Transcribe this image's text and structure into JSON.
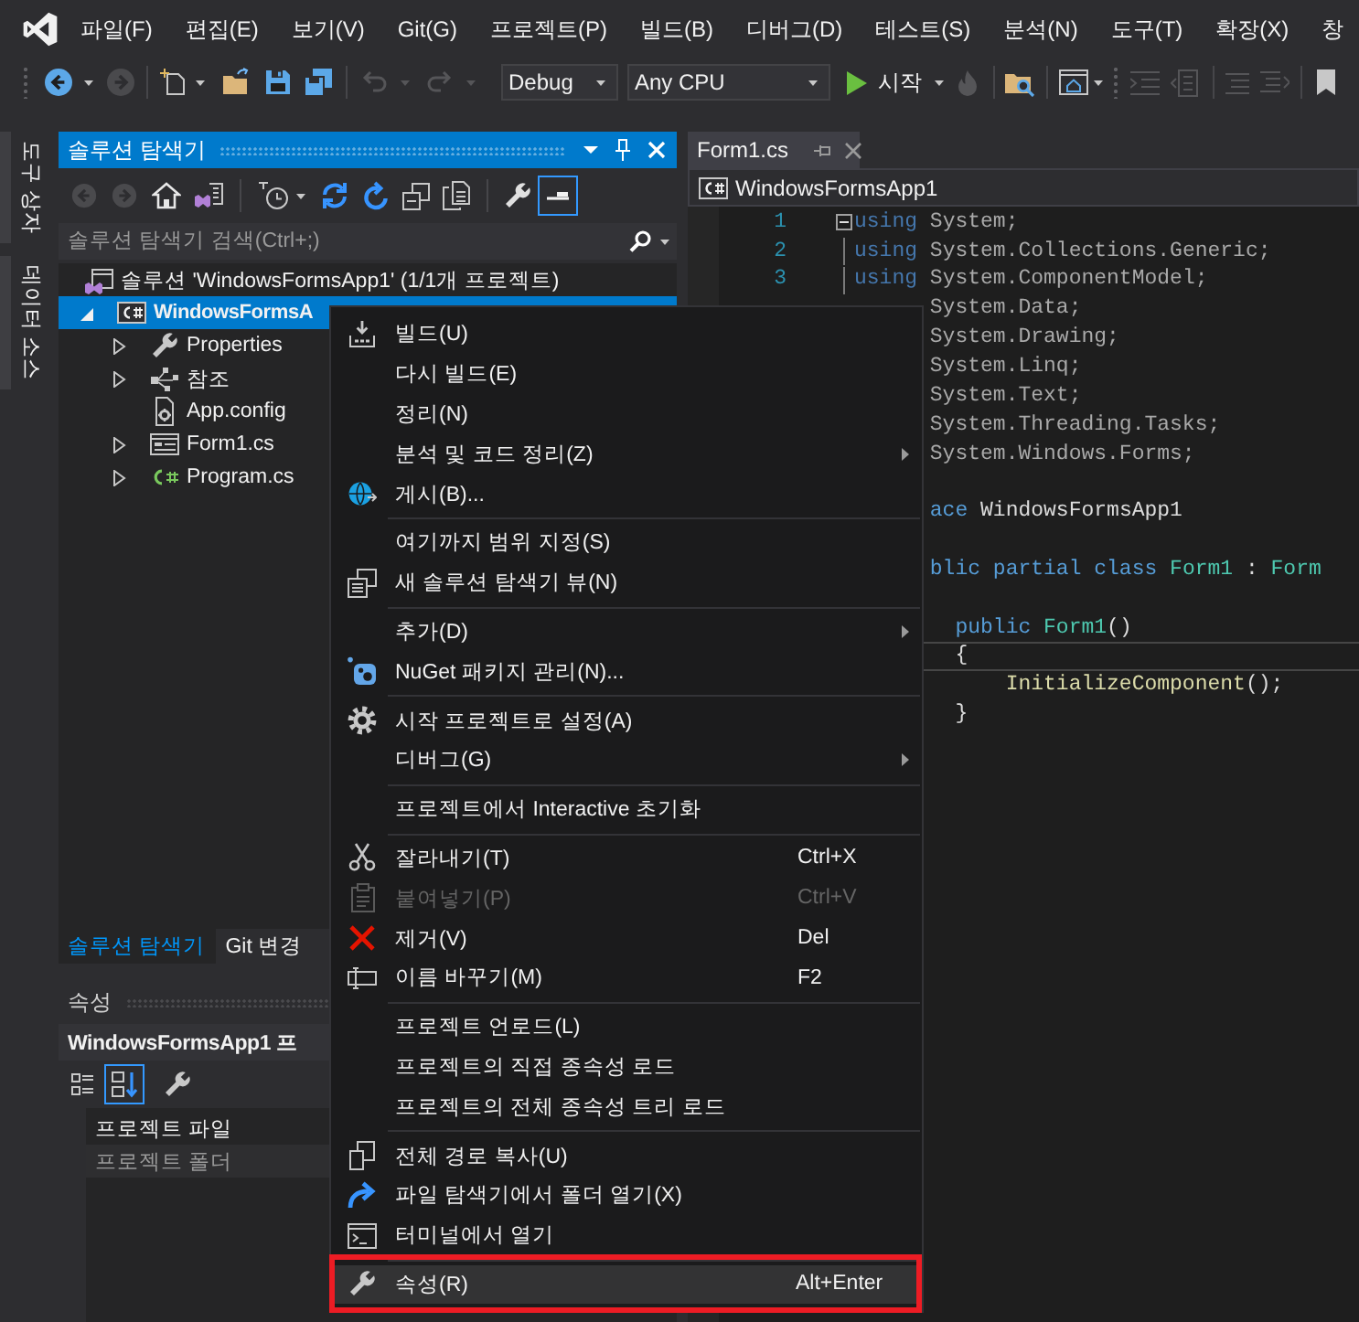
{
  "menu_bar": {
    "items": [
      {
        "label": "파일(F)"
      },
      {
        "label": "편집(E)"
      },
      {
        "label": "보기(V)"
      },
      {
        "label": "Git(G)"
      },
      {
        "label": "프로젝트(P)"
      },
      {
        "label": "빌드(B)"
      },
      {
        "label": "디버그(D)"
      },
      {
        "label": "테스트(S)"
      },
      {
        "label": "분석(N)"
      },
      {
        "label": "도구(T)"
      },
      {
        "label": "확장(X)"
      },
      {
        "label": "창"
      }
    ]
  },
  "toolbar": {
    "history": [
      {
        "disabled": false
      },
      {
        "disabled": true
      }
    ],
    "file": [
      {
        "disabled": false
      },
      {
        "disabled": false
      },
      {
        "disabled": false
      },
      {
        "disabled": false
      }
    ],
    "edit": [
      {
        "disabled": true
      },
      {
        "disabled": true
      }
    ],
    "configuration": "Debug",
    "platform": "Any CPU",
    "start": "시작",
    "tools": [
      {
        "disabled": true
      },
      {
        "disabled": false
      },
      {
        "disabled": false
      },
      {
        "disabled": true
      },
      {
        "disabled": true
      },
      {
        "disabled": true
      },
      {
        "disabled": true
      },
      {
        "disabled": false
      }
    ]
  },
  "side_tabs": [
    {
      "label": "도구 상자"
    },
    {
      "label": "데이터 소스"
    }
  ],
  "solution_explorer": {
    "title": "솔루션 탐색기",
    "active": true,
    "tools": [
      {
        "disabled": true
      },
      {
        "disabled": true
      },
      {
        "disabled": false
      },
      {
        "disabled": false
      },
      {
        "disabled": false
      },
      {
        "disabled": false
      },
      {
        "disabled": false
      },
      {
        "disabled": false
      },
      {
        "disabled": false
      },
      {
        "disabled": false
      }
    ],
    "preview": {
      "on": true
    },
    "search": {
      "placeholder": "솔루션 탐색기 검색(Ctrl+;)"
    },
    "tree": {
      "label": "솔루션 'WindowsFormsApp1' (1/1개 프로젝트)",
      "selected": false,
      "children": [
        {
          "label": "WindowsFormsA",
          "expandable": true,
          "expanded": true,
          "selected": true,
          "startup": true,
          "children": [
            {
              "label": "Properties",
              "expandable": true,
              "expanded": false,
              "selected": false
            },
            {
              "label": "참조",
              "expandable": true,
              "expanded": false,
              "selected": false
            },
            {
              "label": "App.config",
              "expandable": false,
              "selected": false
            },
            {
              "label": "Form1.cs",
              "expandable": true,
              "expanded": false,
              "selected": false
            },
            {
              "label": "Program.cs",
              "expandable": true,
              "expanded": false,
              "selected": false
            }
          ]
        }
      ]
    },
    "tabs": [
      {
        "label": "솔루션 탐색기",
        "selected": true
      },
      {
        "label": "Git 변경",
        "selected": false
      }
    ]
  },
  "properties": {
    "title": "속성",
    "active": false,
    "object": "WindowsFormsApp1 프",
    "sort_buttons": [
      {
        "selected": false
      },
      {
        "selected": true
      }
    ],
    "rows": [
      {
        "name": "프로젝트 파일",
        "selected": false
      },
      {
        "name": "프로젝트 폴더",
        "selected": true
      }
    ]
  },
  "editor": {
    "tabs": [
      {
        "label": "Form1.cs",
        "selected": true
      }
    ],
    "project": "WindowsFormsApp1",
    "lines": [
      {
        "number": "1",
        "fold_start": true,
        "covered": false,
        "current": false,
        "tokens": [
          {
            "kind": "dim_keyword",
            "text": "using"
          },
          {
            "kind": "dim_text",
            "text": " System;"
          }
        ]
      },
      {
        "number": "2",
        "in_fold": true,
        "covered": false,
        "current": false,
        "tokens": [
          {
            "kind": "dim_keyword",
            "text": "using"
          },
          {
            "kind": "dim_text",
            "text": " System.Collections.Generic;"
          }
        ]
      },
      {
        "number": "3",
        "in_fold": true,
        "covered": false,
        "current": false,
        "tokens": [
          {
            "kind": "dim_keyword",
            "text": "using"
          },
          {
            "kind": "dim_text",
            "text": " System.ComponentModel;"
          }
        ]
      },
      {
        "covered": true,
        "current": false,
        "tokens": [
          {
            "kind": "dim_text",
            "text": "System.Data;"
          }
        ]
      },
      {
        "covered": true,
        "current": false,
        "tokens": [
          {
            "kind": "dim_text",
            "text": "System.Drawing;"
          }
        ]
      },
      {
        "covered": true,
        "current": false,
        "tokens": [
          {
            "kind": "dim_text",
            "text": "System.Linq;"
          }
        ]
      },
      {
        "covered": true,
        "current": false,
        "tokens": [
          {
            "kind": "dim_text",
            "text": "System.Text;"
          }
        ]
      },
      {
        "covered": true,
        "current": false,
        "tokens": [
          {
            "kind": "dim_text",
            "text": "System.Threading.Tasks;"
          }
        ]
      },
      {
        "covered": true,
        "current": false,
        "tokens": [
          {
            "kind": "dim_text",
            "text": "System.Windows.Forms;"
          }
        ]
      },
      {
        "current": false
      },
      {
        "covered": true,
        "current": false,
        "tokens": [
          {
            "kind": "keyword",
            "text": "ace"
          },
          {
            "kind": "text",
            "text": " WindowsFormsApp1"
          }
        ]
      },
      {
        "current": false
      },
      {
        "covered": true,
        "current": false,
        "tokens": [
          {
            "kind": "keyword",
            "text": "blic partial class"
          },
          {
            "kind": "type",
            "text": " Form1"
          },
          {
            "kind": "text",
            "text": " :"
          },
          {
            "kind": "type",
            "text": " Form"
          }
        ]
      },
      {
        "current": false
      },
      {
        "covered": true,
        "current": false,
        "tokens": [
          {
            "kind": "keyword",
            "text": "  public"
          },
          {
            "kind": "type",
            "text": " Form1"
          },
          {
            "kind": "text",
            "text": "()"
          }
        ]
      },
      {
        "covered": true,
        "current": true,
        "tokens": [
          {
            "kind": "text",
            "text": "  {"
          }
        ]
      },
      {
        "covered": true,
        "current": false,
        "tokens": [
          {
            "kind": "method",
            "text": "      InitializeComponent"
          },
          {
            "kind": "text",
            "text": "();"
          }
        ]
      },
      {
        "covered": true,
        "current": false,
        "tokens": [
          {
            "kind": "text",
            "text": "  }"
          }
        ]
      }
    ]
  },
  "context_menu": {
    "items": [
      {
        "kind": "command",
        "label": "빌드(U)",
        "disabled": false,
        "selected": false,
        "outlined": false
      },
      {
        "kind": "command",
        "label": "다시 빌드(E)",
        "disabled": false,
        "selected": false,
        "outlined": false
      },
      {
        "kind": "command",
        "label": "정리(N)",
        "disabled": false,
        "selected": false,
        "outlined": false
      },
      {
        "kind": "submenu",
        "label": "분석 및 코드 정리(Z)",
        "disabled": false,
        "selected": false,
        "outlined": false
      },
      {
        "kind": "command",
        "label": "게시(B)...",
        "disabled": false,
        "selected": false,
        "outlined": false
      },
      {
        "kind": "separator"
      },
      {
        "kind": "command",
        "label": "여기까지 범위 지정(S)",
        "disabled": false,
        "selected": false,
        "outlined": false
      },
      {
        "kind": "command",
        "label": "새 솔루션 탐색기 뷰(N)",
        "disabled": false,
        "selected": false,
        "outlined": false
      },
      {
        "kind": "separator"
      },
      {
        "kind": "submenu",
        "label": "추가(D)",
        "disabled": false,
        "selected": false,
        "outlined": false
      },
      {
        "kind": "command",
        "label": "NuGet 패키지 관리(N)...",
        "disabled": false,
        "selected": false,
        "outlined": false
      },
      {
        "kind": "separator"
      },
      {
        "kind": "command",
        "label": "시작 프로젝트로 설정(A)",
        "disabled": false,
        "selected": false,
        "outlined": false
      },
      {
        "kind": "submenu",
        "label": "디버그(G)",
        "disabled": false,
        "selected": false,
        "outlined": false
      },
      {
        "kind": "separator"
      },
      {
        "kind": "command",
        "label": "프로젝트에서 Interactive 초기화",
        "disabled": false,
        "selected": false,
        "outlined": false
      },
      {
        "kind": "separator"
      },
      {
        "kind": "command",
        "label": "잘라내기(T)",
        "shortcut": "Ctrl+X",
        "disabled": false,
        "selected": false,
        "outlined": false
      },
      {
        "kind": "command",
        "label": "붙여넣기(P)",
        "shortcut": "Ctrl+V",
        "disabled": true,
        "selected": false,
        "outlined": false
      },
      {
        "kind": "command",
        "label": "제거(V)",
        "shortcut": "Del",
        "disabled": false,
        "selected": false,
        "outlined": false
      },
      {
        "kind": "command",
        "label": "이름 바꾸기(M)",
        "shortcut": "F2",
        "disabled": false,
        "selected": false,
        "outlined": false
      },
      {
        "kind": "separator"
      },
      {
        "kind": "command",
        "label": "프로젝트 언로드(L)",
        "disabled": false,
        "selected": false,
        "outlined": false
      },
      {
        "kind": "command",
        "label": "프로젝트의 직접 종속성 로드",
        "disabled": false,
        "selected": false,
        "outlined": false
      },
      {
        "kind": "command",
        "label": "프로젝트의 전체 종속성 트리 로드",
        "disabled": false,
        "selected": false,
        "outlined": false
      },
      {
        "kind": "separator"
      },
      {
        "kind": "command",
        "label": "전체 경로 복사(U)",
        "disabled": false,
        "selected": false,
        "outlined": false
      },
      {
        "kind": "command",
        "label": "파일 탐색기에서 폴더 열기(X)",
        "disabled": false,
        "selected": false,
        "outlined": false
      },
      {
        "kind": "command",
        "label": "터미널에서 열기",
        "disabled": false,
        "selected": false,
        "outlined": false
      },
      {
        "kind": "separator"
      },
      {
        "kind": "command",
        "label": "속성(R)",
        "shortcut": "Alt+Enter",
        "disabled": false,
        "selected": true,
        "outlined": true
      }
    ]
  }
}
